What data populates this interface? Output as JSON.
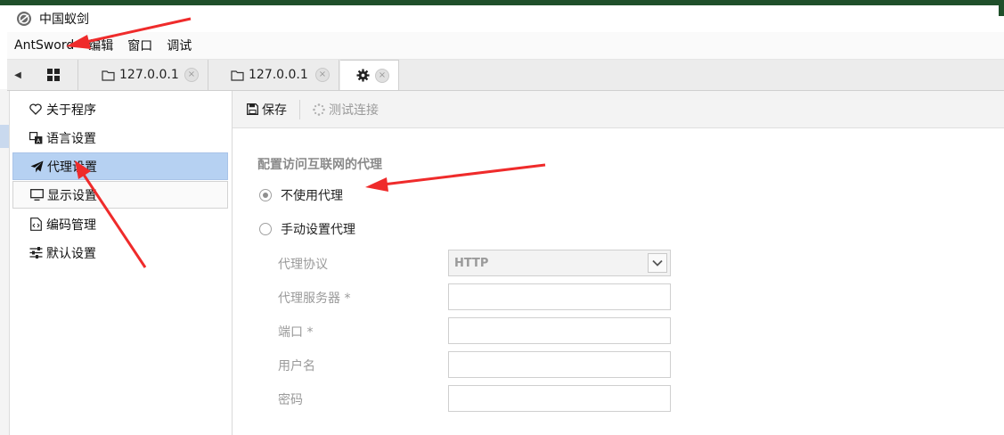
{
  "window": {
    "title": "中国蚁剑"
  },
  "menubar": {
    "items": [
      "AntSword",
      "编辑",
      "窗口",
      "调试"
    ]
  },
  "tabs": {
    "items": [
      {
        "label": "127.0.0.1",
        "close": "×"
      },
      {
        "label": "127.0.0.1",
        "close": "×"
      }
    ],
    "settings_close": "×",
    "scroll_left": "◀"
  },
  "sidebar": {
    "items": [
      {
        "label": "关于程序"
      },
      {
        "label": "语言设置"
      },
      {
        "label": "代理设置"
      },
      {
        "label": "显示设置"
      },
      {
        "label": "编码管理"
      },
      {
        "label": "默认设置"
      }
    ],
    "active_index": 2
  },
  "toolbar": {
    "save_label": "保存",
    "test_label": "测试连接"
  },
  "proxy": {
    "section_title": "配置访问互联网的代理",
    "options": [
      "不使用代理",
      "手动设置代理"
    ],
    "selected_option": 0,
    "fields": {
      "protocol_label": "代理协议",
      "protocol_value": "HTTP",
      "server_label": "代理服务器 *",
      "server_value": "",
      "port_label": "端口 *",
      "port_value": "",
      "username_label": "用户名",
      "username_value": "",
      "password_label": "密码",
      "password_value": ""
    }
  },
  "colors": {
    "accent_selection": "#b6d1f2",
    "annotation_arrow": "#ef2b2b",
    "background_window": "#1f4f2a"
  }
}
